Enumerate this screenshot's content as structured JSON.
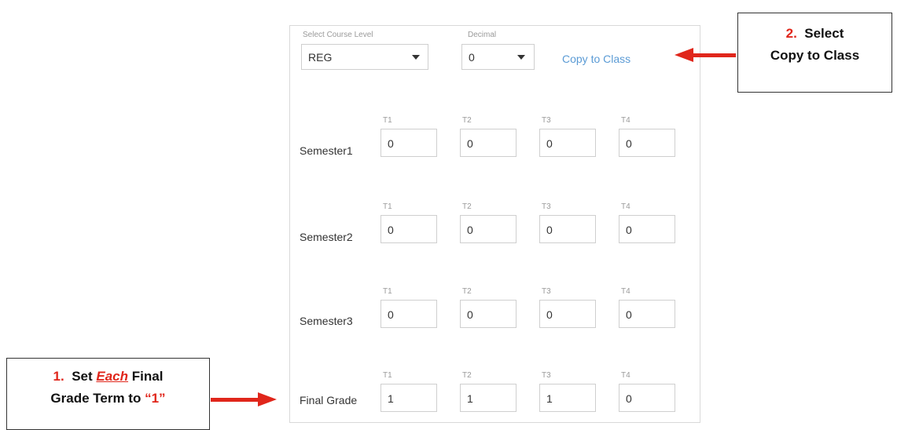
{
  "panel": {
    "course_level_label": "Select Course Level",
    "course_level_value": "REG",
    "decimal_label": "Decimal",
    "decimal_value": "0",
    "copy_link": "Copy to Class"
  },
  "rows": [
    {
      "label": "Semester1",
      "terms": [
        "T1",
        "T2",
        "T3",
        "T4"
      ],
      "values": [
        "0",
        "0",
        "0",
        "0"
      ]
    },
    {
      "label": "Semester2",
      "terms": [
        "T1",
        "T2",
        "T3",
        "T4"
      ],
      "values": [
        "0",
        "0",
        "0",
        "0"
      ]
    },
    {
      "label": "Semester3",
      "terms": [
        "T1",
        "T2",
        "T3",
        "T4"
      ],
      "values": [
        "0",
        "0",
        "0",
        "0"
      ]
    },
    {
      "label": "Final Grade",
      "terms": [
        "T1",
        "T2",
        "T3",
        "T4"
      ],
      "values": [
        "1",
        "1",
        "1",
        "0"
      ]
    }
  ],
  "callouts": {
    "step2": {
      "number": "2.",
      "line1": "Select",
      "line2": "Copy to Class"
    },
    "step1": {
      "number": "1.",
      "pre": "Set",
      "each": "Each",
      "post": "Final",
      "line2_pre": "Grade Term to",
      "line2_val": "“1”"
    }
  },
  "colors": {
    "accent": "#e0261b",
    "link": "#5b9bd5"
  }
}
